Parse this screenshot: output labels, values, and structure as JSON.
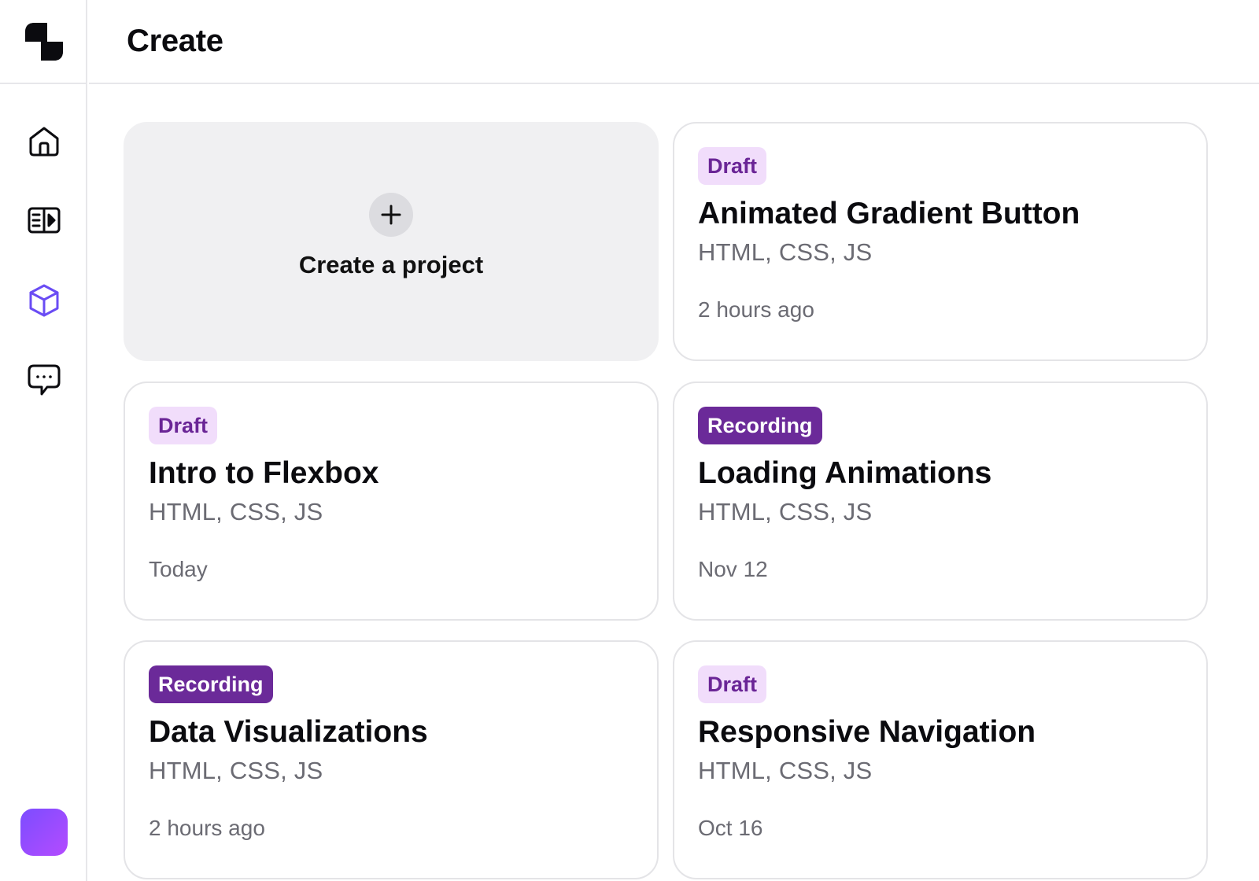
{
  "header": {
    "title": "Create"
  },
  "sidebar": {
    "items": [
      {
        "name": "home",
        "icon": "home-icon",
        "active": false
      },
      {
        "name": "library",
        "icon": "video-library-icon",
        "active": false
      },
      {
        "name": "create",
        "icon": "cube-icon",
        "active": true
      },
      {
        "name": "messages",
        "icon": "chat-bubble-icon",
        "active": false
      }
    ],
    "active_color": "#6a4cf4"
  },
  "create_card": {
    "label": "Create a project",
    "icon": "plus-icon"
  },
  "projects": [
    {
      "status": "Draft",
      "title": "Animated Gradient Button",
      "tech": "HTML, CSS, JS",
      "time": "2 hours ago"
    },
    {
      "status": "Draft",
      "title": "Intro to Flexbox",
      "tech": "HTML, CSS, JS",
      "time": "Today"
    },
    {
      "status": "Recording",
      "title": "Loading Animations",
      "tech": "HTML, CSS, JS",
      "time": "Nov 12"
    },
    {
      "status": "Recording",
      "title": "Data Visualizations",
      "tech": "HTML, CSS, JS",
      "time": "2 hours ago"
    },
    {
      "status": "Draft",
      "title": "Responsive Navigation",
      "tech": "HTML, CSS, JS",
      "time": "Oct 16"
    }
  ],
  "colors": {
    "draft_bg": "#f1ddfb",
    "draft_text": "#6a2596",
    "recording_bg": "#6b2a99",
    "recording_text": "#ffffff",
    "avatar_gradient": [
      "#7c4dff",
      "#b44bff"
    ]
  }
}
